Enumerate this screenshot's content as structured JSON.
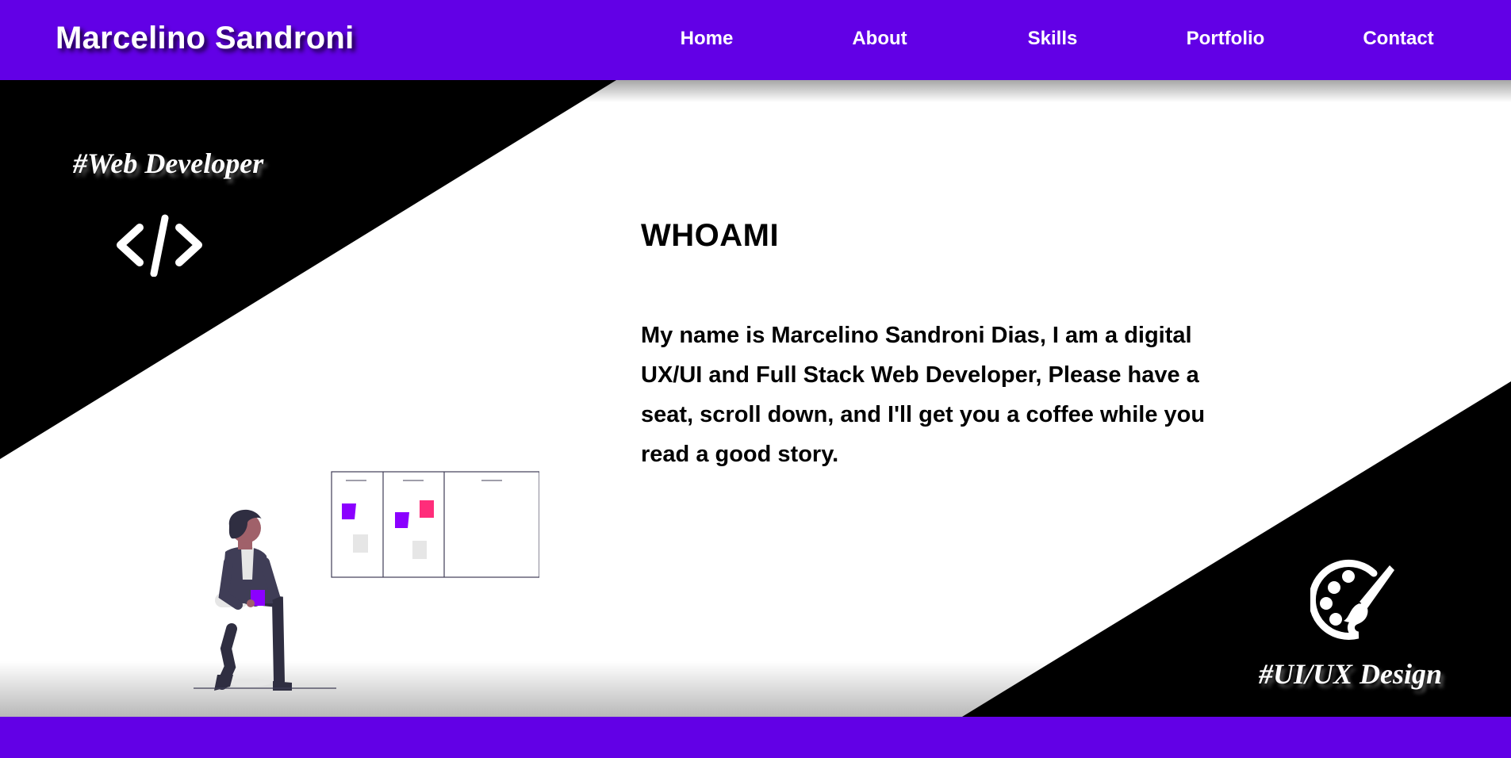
{
  "header": {
    "brand": "Marcelino Sandroni",
    "nav": [
      {
        "label": "Home"
      },
      {
        "label": "About"
      },
      {
        "label": "Skills"
      },
      {
        "label": "Portfolio"
      },
      {
        "label": "Contact"
      }
    ]
  },
  "hero": {
    "tag_left": "#Web Developer",
    "code_symbol": "</>",
    "tag_right": "#UI/UX Design",
    "title": "WHOAMI",
    "bio": "My name is Marcelino Sandroni Dias, I am a digital UX/UI and Full Stack Web Developer, Please have a seat, scroll down, and I'll get you a coffee while you read a good story.",
    "icons": {
      "code": "code-icon",
      "palette": "palette-icon",
      "illustration": "person-waiting-kanban-illustration"
    }
  },
  "colors": {
    "brand": "#6200e6",
    "dark": "#000000",
    "light": "#ffffff",
    "sticky_purple": "#8b00ff",
    "sticky_pink": "#ff2d7a"
  }
}
